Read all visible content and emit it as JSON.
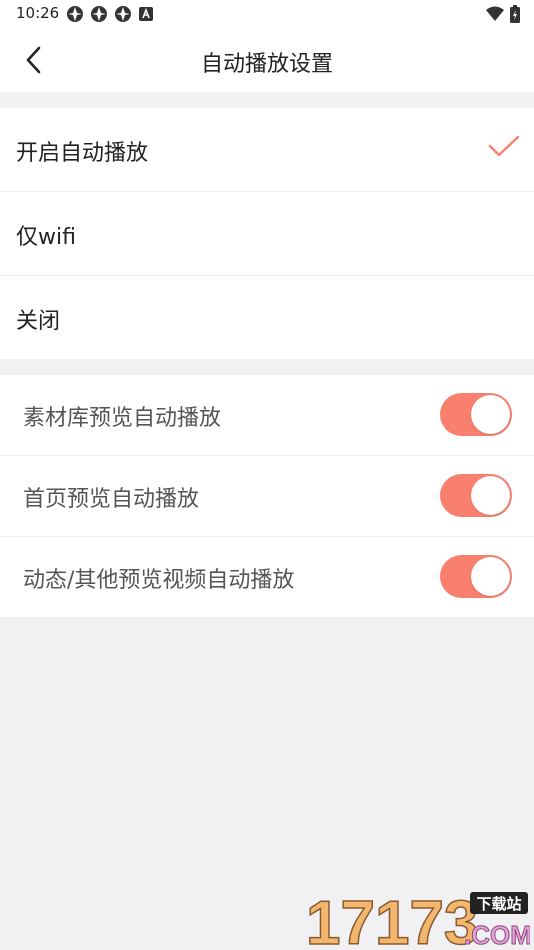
{
  "status_bar": {
    "time": "10:26",
    "notification_icons": [
      "aperture-icon",
      "aperture-icon",
      "aperture-icon",
      "a-box-icon"
    ],
    "right_icons": [
      "wifi-icon",
      "battery-icon"
    ]
  },
  "header": {
    "title": "自动播放设置"
  },
  "autoplay_options": {
    "items": [
      {
        "label": "开启自动播放",
        "selected": true
      },
      {
        "label": "仅wifi",
        "selected": false
      },
      {
        "label": "关闭",
        "selected": false
      }
    ]
  },
  "preview_settings": {
    "items": [
      {
        "label": "素材库预览自动播放",
        "enabled": true
      },
      {
        "label": "首页预览自动播放",
        "enabled": true
      },
      {
        "label": "动态/其他预览视频自动播放",
        "enabled": true
      }
    ]
  },
  "watermark": {
    "text_main": "17173",
    "text_badge": "下载站",
    "text_com": ".COM"
  },
  "colors": {
    "accent": "#f9806f",
    "background": "#f1f1f3"
  }
}
